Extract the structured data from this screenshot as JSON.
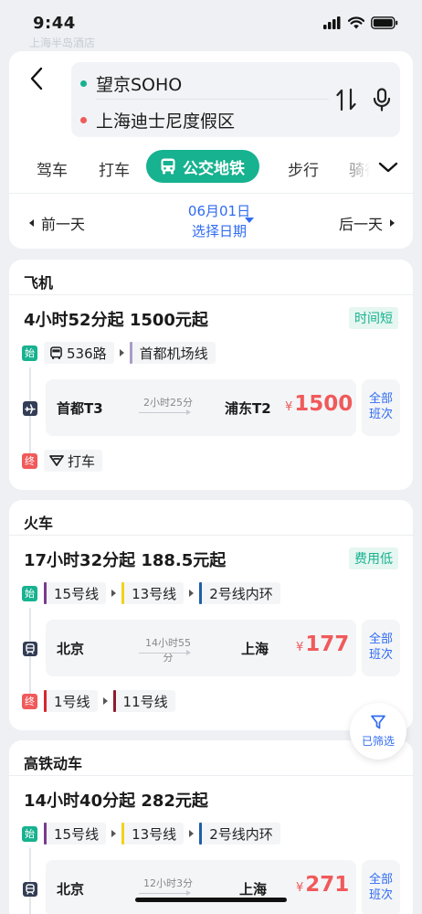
{
  "status": {
    "time": "9:44"
  },
  "bg_ghost": "上海半岛酒店",
  "route": {
    "from": "望京SOHO",
    "to": "上海迪士尼度假区"
  },
  "modes": {
    "drive": "驾车",
    "taxi": "打车",
    "transit": "公交地铁",
    "walk": "步行",
    "ride": "骑行"
  },
  "date": {
    "prev": "前一天",
    "date": "06月01日",
    "choose": "选择日期",
    "next": "后一天"
  },
  "colors": {
    "accent": "#17b28f",
    "link": "#2f6bf2",
    "price": "#f05a5a"
  },
  "plane": {
    "title": "飞机",
    "summary": "4小时52分起   1500元起",
    "tag": "时间短",
    "start_badge": "始",
    "end_badge": "终",
    "start_legs": [
      {
        "label": "536路",
        "icon": "bus-icon"
      },
      {
        "label": "首都机场线",
        "color": "#a99cc8"
      }
    ],
    "trip": {
      "icon": "airplane-icon",
      "from": "首都T3",
      "duration": "2小时25分",
      "to": "浦东T2",
      "currency": "¥",
      "price": "1500",
      "all": "全部\n班次"
    },
    "end_legs": [
      {
        "label": "打车",
        "icon": "taxi-icon"
      }
    ]
  },
  "train": {
    "title": "火车",
    "summary": "17小时32分起   188.5元起",
    "tag": "费用低",
    "start_badge": "始",
    "end_badge": "终",
    "start_legs": [
      {
        "label": "15号线",
        "color": "#7a3b8c"
      },
      {
        "label": "13号线",
        "color": "#f2d21b"
      },
      {
        "label": "2号线内环",
        "color": "#1f5fa8"
      }
    ],
    "trip": {
      "icon": "train-icon",
      "from": "北京",
      "duration": "14小时55分",
      "to": "上海",
      "currency": "¥",
      "price": "177",
      "all": "全部\n班次"
    },
    "end_legs": [
      {
        "label": "1号线",
        "color": "#d8262e"
      },
      {
        "label": "11号线",
        "color": "#8e1b2e"
      }
    ]
  },
  "hsr": {
    "title": "高铁动车",
    "summary": "14小时40分起   282元起",
    "start_badge": "始",
    "start_legs": [
      {
        "label": "15号线",
        "color": "#7a3b8c"
      },
      {
        "label": "13号线",
        "color": "#f2d21b"
      },
      {
        "label": "2号线内环",
        "color": "#1f5fa8"
      }
    ],
    "trip": {
      "icon": "train-icon",
      "from": "北京",
      "duration": "12小时3分",
      "to": "上海",
      "currency": "¥",
      "price": "271",
      "all": "全部\n班次"
    }
  },
  "filter": {
    "label": "已筛选"
  }
}
